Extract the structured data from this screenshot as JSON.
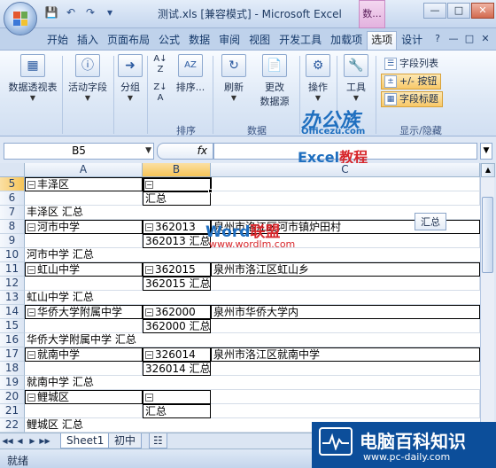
{
  "window": {
    "title": "测试.xls  [兼容模式] - Microsoft Excel",
    "contextual_tab": "数..."
  },
  "tabs": [
    "开始",
    "插入",
    "页面布局",
    "公式",
    "数据",
    "审阅",
    "视图",
    "开发工具",
    "加载项",
    "选项",
    "设计"
  ],
  "active_tab": "选项",
  "ribbon": {
    "pivot_table": "数据透视表",
    "active_field": "活动字段",
    "group": "分组",
    "sort": "排序...",
    "sort_group_label": "排序",
    "refresh": "刷新",
    "change_source_1": "更改",
    "change_source_2": "数据源",
    "data_group_label": "数据",
    "actions": "操作",
    "tools": "工具",
    "field_list": "字段列表",
    "plus_minus_buttons": "+/- 按钮",
    "field_headers": "字段标题",
    "show_hide_label": "显示/隐藏"
  },
  "watermarks": {
    "bgz_main": "办公族",
    "bgz_sub": "Officezu.com",
    "excel_tutorial_a": "Excel",
    "excel_tutorial_b": "教程",
    "word_a": "Word",
    "word_b": "联盟",
    "word_url": "www.wordlm.com",
    "pc_daily_main": "电脑百科知识",
    "pc_daily_url": "www.pc-daily.com"
  },
  "formula_bar": {
    "name_box": "B5",
    "fx": "fx",
    "formula": ""
  },
  "columns": [
    "A",
    "B",
    "C"
  ],
  "rows": [
    {
      "num": "5",
      "a": "丰泽区",
      "a_minus": true,
      "b": "",
      "b_minus": true,
      "c": ""
    },
    {
      "num": "6",
      "a": "",
      "b": "汇总",
      "c": ""
    },
    {
      "num": "7",
      "span": "丰泽区 汇总"
    },
    {
      "num": "8",
      "a": "河市中学",
      "a_minus": true,
      "b": "362013",
      "b_minus": true,
      "c": "泉州市洛江区河市镇炉田村"
    },
    {
      "num": "9",
      "a": "",
      "b": "362013 汇总",
      "c": ""
    },
    {
      "num": "10",
      "span": "河市中学 汇总"
    },
    {
      "num": "11",
      "a": "虹山中学",
      "a_minus": true,
      "b": "362015",
      "b_minus": true,
      "c": "泉州市洛江区虹山乡"
    },
    {
      "num": "12",
      "a": "",
      "b": "362015 汇总",
      "c": ""
    },
    {
      "num": "13",
      "span": "虹山中学 汇总"
    },
    {
      "num": "14",
      "a": "华侨大学附属中学",
      "a_minus": true,
      "b": "362000",
      "b_minus": true,
      "c": "泉州市华侨大学内"
    },
    {
      "num": "15",
      "a": "",
      "b": "362000 汇总",
      "c": ""
    },
    {
      "num": "16",
      "span": "华侨大学附属中学 汇总"
    },
    {
      "num": "17",
      "a": "就南中学",
      "a_minus": true,
      "b": "326014",
      "b_minus": true,
      "c": "泉州市洛江区就南中学"
    },
    {
      "num": "18",
      "a": "",
      "b": "326014 汇总",
      "c": ""
    },
    {
      "num": "19",
      "span": "就南中学 汇总"
    },
    {
      "num": "20",
      "a": "鲤城区",
      "a_minus": true,
      "b": "",
      "b_minus": true,
      "c": ""
    },
    {
      "num": "21",
      "a": "",
      "b": "汇总",
      "c": ""
    },
    {
      "num": "22",
      "span": "鲤城区 汇总"
    }
  ],
  "tooltip": "汇总",
  "sheets": [
    "Sheet1",
    "初中"
  ],
  "status": "就绪"
}
